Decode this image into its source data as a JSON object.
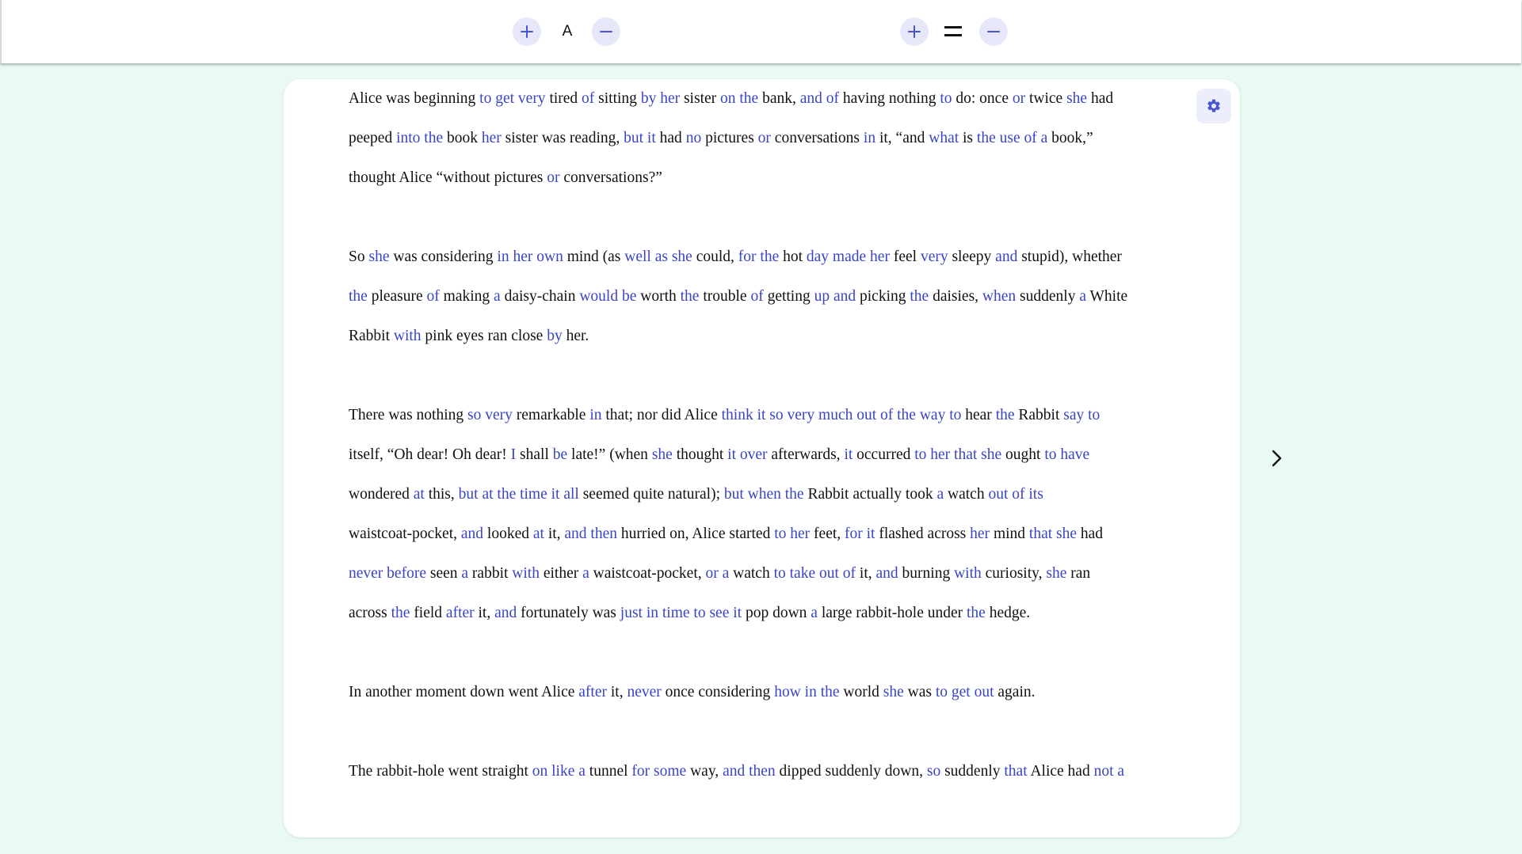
{
  "toolbar": {
    "font_size_increase_label": "+",
    "font_label": "A",
    "font_size_decrease_label": "−",
    "line_spacing_increase_label": "+",
    "line_spacing_decrease_label": "−"
  },
  "colors": {
    "background": "#e9faf2",
    "highlight": "#3a45c2",
    "button_bg": "#e6e8fa",
    "accent": "#4a55d6"
  },
  "icons": {
    "settings": "gear-icon",
    "next": "chevron-right-icon",
    "line_spacing": "line-spacing-icon"
  },
  "paragraphs": [
    {
      "lines": [
        [
          [
            "Alice was beginning ",
            false
          ],
          [
            "to get very",
            true
          ],
          [
            " tired ",
            false
          ],
          [
            "of",
            true
          ],
          [
            " sitting ",
            false
          ],
          [
            "by her",
            true
          ],
          [
            " sister ",
            false
          ],
          [
            "on the",
            true
          ],
          [
            " bank, ",
            false
          ],
          [
            "and of",
            true
          ],
          [
            " having nothing ",
            false
          ],
          [
            "to",
            true
          ],
          [
            " do: once ",
            false
          ],
          [
            "or",
            true
          ],
          [
            " twice ",
            false
          ],
          [
            "she",
            true
          ],
          [
            " had",
            false
          ]
        ],
        [
          [
            "peeped ",
            false
          ],
          [
            "into the",
            true
          ],
          [
            " book ",
            false
          ],
          [
            "her",
            true
          ],
          [
            " sister was reading, ",
            false
          ],
          [
            "but it",
            true
          ],
          [
            " had ",
            false
          ],
          [
            "no",
            true
          ],
          [
            " pictures ",
            false
          ],
          [
            "or",
            true
          ],
          [
            " conversations ",
            false
          ],
          [
            "in",
            true
          ],
          [
            " it, “and ",
            false
          ],
          [
            "what",
            true
          ],
          [
            " is ",
            false
          ],
          [
            "the use of a",
            true
          ],
          [
            " book,”",
            false
          ]
        ],
        [
          [
            "thought Alice “without pictures ",
            false
          ],
          [
            "or",
            true
          ],
          [
            " conversations?”",
            false
          ]
        ]
      ]
    },
    {
      "lines": [
        [
          [
            "So ",
            false
          ],
          [
            "she",
            true
          ],
          [
            " was considering ",
            false
          ],
          [
            "in her own",
            true
          ],
          [
            " mind (as ",
            false
          ],
          [
            "well as she",
            true
          ],
          [
            " could, ",
            false
          ],
          [
            "for the",
            true
          ],
          [
            " hot ",
            false
          ],
          [
            "day made her",
            true
          ],
          [
            " feel ",
            false
          ],
          [
            "very",
            true
          ],
          [
            " sleepy ",
            false
          ],
          [
            "and",
            true
          ],
          [
            " stupid), whether",
            false
          ]
        ],
        [
          [
            "the",
            true
          ],
          [
            " pleasure ",
            false
          ],
          [
            "of",
            true
          ],
          [
            " making ",
            false
          ],
          [
            "a",
            true
          ],
          [
            " daisy-chain ",
            false
          ],
          [
            "would be",
            true
          ],
          [
            " worth ",
            false
          ],
          [
            "the",
            true
          ],
          [
            " trouble ",
            false
          ],
          [
            "of",
            true
          ],
          [
            " getting ",
            false
          ],
          [
            "up and",
            true
          ],
          [
            " picking ",
            false
          ],
          [
            "the",
            true
          ],
          [
            " daisies, ",
            false
          ],
          [
            "when",
            true
          ],
          [
            " suddenly ",
            false
          ],
          [
            "a",
            true
          ],
          [
            " White",
            false
          ]
        ],
        [
          [
            "Rabbit ",
            false
          ],
          [
            "with",
            true
          ],
          [
            " pink eyes ran close ",
            false
          ],
          [
            "by",
            true
          ],
          [
            " her.",
            false
          ]
        ]
      ]
    },
    {
      "lines": [
        [
          [
            "There was nothing ",
            false
          ],
          [
            "so very",
            true
          ],
          [
            " remarkable ",
            false
          ],
          [
            "in",
            true
          ],
          [
            " that; nor did Alice ",
            false
          ],
          [
            "think it so very much out of the way to",
            true
          ],
          [
            " hear ",
            false
          ],
          [
            "the",
            true
          ],
          [
            " Rabbit ",
            false
          ],
          [
            "say to",
            true
          ]
        ],
        [
          [
            "itself, “Oh dear! Oh dear! ",
            false
          ],
          [
            "I",
            true
          ],
          [
            " shall ",
            false
          ],
          [
            "be",
            true
          ],
          [
            " late!” (when ",
            false
          ],
          [
            "she",
            true
          ],
          [
            " thought ",
            false
          ],
          [
            "it over",
            true
          ],
          [
            " afterwards, ",
            false
          ],
          [
            "it",
            true
          ],
          [
            " occurred ",
            false
          ],
          [
            "to her that she",
            true
          ],
          [
            " ought ",
            false
          ],
          [
            "to have",
            true
          ]
        ],
        [
          [
            "wondered ",
            false
          ],
          [
            "at",
            true
          ],
          [
            " this, ",
            false
          ],
          [
            "but at the time it all",
            true
          ],
          [
            " seemed quite natural); ",
            false
          ],
          [
            "but when the",
            true
          ],
          [
            " Rabbit actually took ",
            false
          ],
          [
            "a",
            true
          ],
          [
            " watch ",
            false
          ],
          [
            "out of its",
            true
          ]
        ],
        [
          [
            "waistcoat-pocket, ",
            false
          ],
          [
            "and",
            true
          ],
          [
            " looked ",
            false
          ],
          [
            "at",
            true
          ],
          [
            " it, ",
            false
          ],
          [
            "and then",
            true
          ],
          [
            " hurried on, Alice started ",
            false
          ],
          [
            "to her",
            true
          ],
          [
            " feet, ",
            false
          ],
          [
            "for it",
            true
          ],
          [
            " flashed across ",
            false
          ],
          [
            "her",
            true
          ],
          [
            " mind ",
            false
          ],
          [
            "that she",
            true
          ],
          [
            " had",
            false
          ]
        ],
        [
          [
            "never before",
            true
          ],
          [
            " seen ",
            false
          ],
          [
            "a",
            true
          ],
          [
            " rabbit ",
            false
          ],
          [
            "with",
            true
          ],
          [
            " either ",
            false
          ],
          [
            "a",
            true
          ],
          [
            " waistcoat-pocket, ",
            false
          ],
          [
            "or a",
            true
          ],
          [
            " watch ",
            false
          ],
          [
            "to take out of",
            true
          ],
          [
            " it, ",
            false
          ],
          [
            "and",
            true
          ],
          [
            " burning ",
            false
          ],
          [
            "with",
            true
          ],
          [
            " curiosity, ",
            false
          ],
          [
            "she",
            true
          ],
          [
            " ran",
            false
          ]
        ],
        [
          [
            "across ",
            false
          ],
          [
            "the",
            true
          ],
          [
            " field ",
            false
          ],
          [
            "after",
            true
          ],
          [
            " it, ",
            false
          ],
          [
            "and",
            true
          ],
          [
            " fortunately was ",
            false
          ],
          [
            "just in time to see it",
            true
          ],
          [
            " pop down ",
            false
          ],
          [
            "a",
            true
          ],
          [
            " large rabbit-hole under ",
            false
          ],
          [
            "the",
            true
          ],
          [
            " hedge.",
            false
          ]
        ]
      ]
    },
    {
      "lines": [
        [
          [
            "In another moment down went Alice ",
            false
          ],
          [
            "after",
            true
          ],
          [
            " it, ",
            false
          ],
          [
            "never",
            true
          ],
          [
            " once considering ",
            false
          ],
          [
            "how in the",
            true
          ],
          [
            " world ",
            false
          ],
          [
            "she",
            true
          ],
          [
            " was ",
            false
          ],
          [
            "to get out",
            true
          ],
          [
            " again.",
            false
          ]
        ]
      ]
    },
    {
      "lines": [
        [
          [
            "The rabbit-hole went straight ",
            false
          ],
          [
            "on like a",
            true
          ],
          [
            " tunnel ",
            false
          ],
          [
            "for some",
            true
          ],
          [
            " way, ",
            false
          ],
          [
            "and then",
            true
          ],
          [
            " dipped suddenly down, ",
            false
          ],
          [
            "so",
            true
          ],
          [
            " suddenly ",
            false
          ],
          [
            "that",
            true
          ],
          [
            " Alice had ",
            false
          ],
          [
            "not a",
            true
          ]
        ]
      ]
    }
  ]
}
